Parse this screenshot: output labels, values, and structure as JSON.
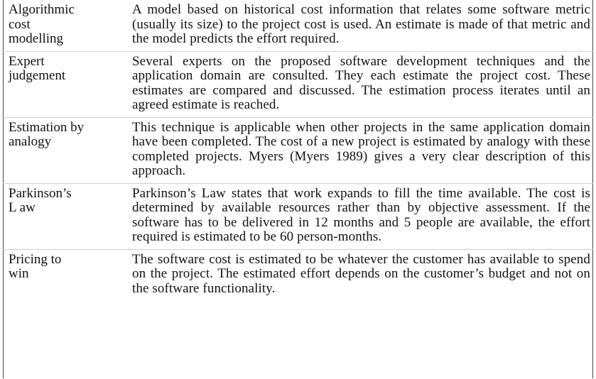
{
  "techniques": [
    {
      "name": "Algorithmic\ncost\nmodelling",
      "description": "A model based on historical cost information that relates some software metric (usually its size) to the project cost is used. An estimate is made of that metric and the model predicts the effort required."
    },
    {
      "name": "Expert\njudgement",
      "description": "Several experts on the proposed software development techniques and the application domain are consulted. They each estimate the project cost. These estimates are compared and discussed. The estimation process iterates until an agreed estimate is reached."
    },
    {
      "name": "Estimation by\nanalogy",
      "description": "This technique is applicable when other projects in the same application domain have been completed. The cost of a new project is estimated by analogy with these completed projects. Myers (Myers 1989) gives a very clear description of this approach."
    },
    {
      "name": "Parkinson’s\nL aw",
      "description": "Parkinson’s Law states that work expands to fill the time available. The cost is determined by available resources rather than by objective assessment. If the software has to be delivered in 12 months and 5 people are available, the effort required is estimated to be 60 person-months."
    },
    {
      "name": "Pricing to\nwin",
      "description": "The software cost is estimated to be whatever the customer has available to spend on the project. The estimated effort depends on the customer’s budget and not on the software functionality."
    }
  ]
}
